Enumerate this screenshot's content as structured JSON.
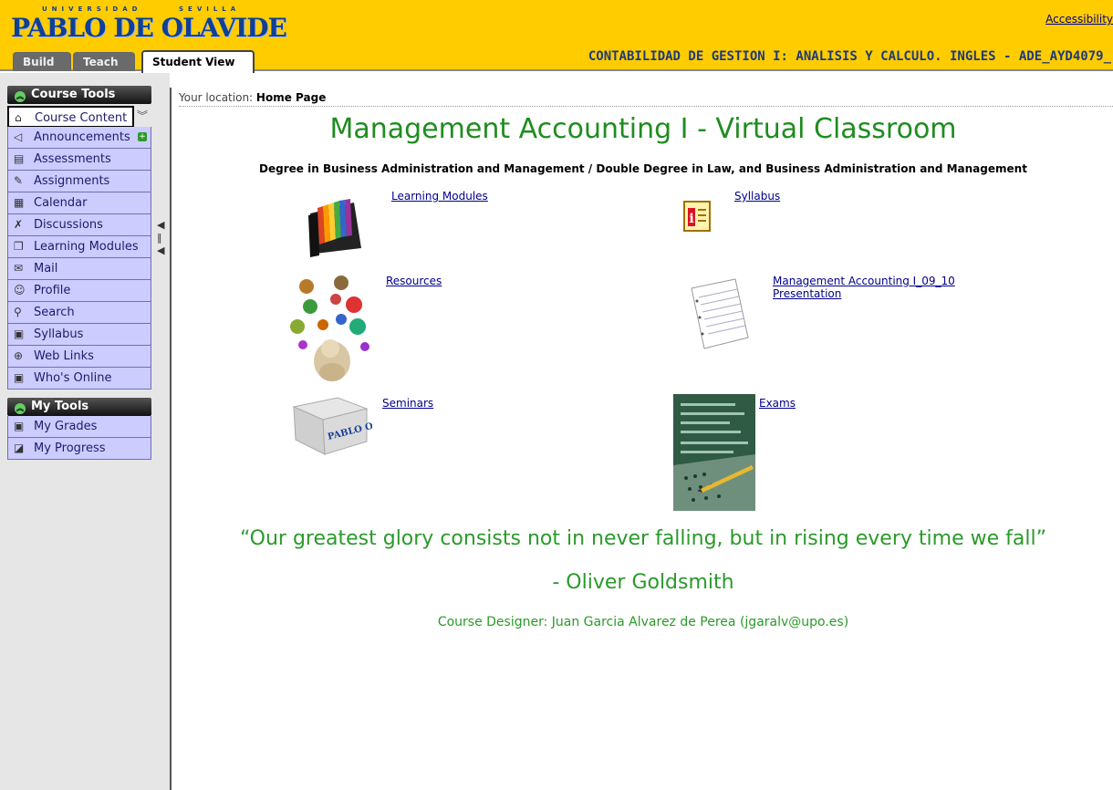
{
  "header": {
    "logo_small_left": "UNIVERSIDAD",
    "logo_small_right": "SEVILLA",
    "logo_text": "PABLO DE OLAVIDE",
    "accessibility_link": "Accessibility",
    "course_title": "CONTABILIDAD DE GESTION I: ANALISIS Y CALCULO. INGLES - ADE_AYD4079_",
    "tabs": [
      {
        "label": "Build"
      },
      {
        "label": "Teach"
      },
      {
        "label": "Student View"
      }
    ]
  },
  "sidebar": {
    "course_tools_header": "Course Tools",
    "course_tools": [
      {
        "label": "Course Content",
        "icon": "home-icon"
      },
      {
        "label": "Announcements",
        "icon": "megaphone-icon"
      },
      {
        "label": "Assessments",
        "icon": "assessment-icon"
      },
      {
        "label": "Assignments",
        "icon": "assignment-icon"
      },
      {
        "label": "Calendar",
        "icon": "calendar-icon"
      },
      {
        "label": "Discussions",
        "icon": "discussion-icon"
      },
      {
        "label": "Learning Modules",
        "icon": "module-icon"
      },
      {
        "label": "Mail",
        "icon": "mail-icon"
      },
      {
        "label": "Profile",
        "icon": "profile-icon"
      },
      {
        "label": "Search",
        "icon": "search-icon"
      },
      {
        "label": "Syllabus",
        "icon": "syllabus-icon"
      },
      {
        "label": "Web Links",
        "icon": "globe-icon"
      },
      {
        "label": "Who's Online",
        "icon": "online-icon"
      }
    ],
    "my_tools_header": "My Tools",
    "my_tools": [
      {
        "label": "My Grades",
        "icon": "grades-icon"
      },
      {
        "label": "My Progress",
        "icon": "progress-icon"
      }
    ]
  },
  "content": {
    "location_label": "Your location:",
    "location_value": "Home Page",
    "title": "Management Accounting I - Virtual Classroom",
    "degree_line": "Degree in Business Administration and Management / Double Degree in Law, and  Business Administration and Management",
    "links": {
      "learning_modules": "Learning Modules",
      "syllabus": "Syllabus",
      "resources": "Resources",
      "presentation_line1": "Management Accounting I_09_10",
      "presentation_line2": "Presentation",
      "seminars": "Seminars",
      "exams": "Exams"
    },
    "quote": "“Our greatest glory consists not in never falling, but in rising every time we fall”",
    "author": "- Oliver Goldsmith",
    "designer": "Course Designer: Juan Garcia Alvarez de Perea (jgaralv@upo.es)",
    "box_logo_text": "PABLO OLAVIDE"
  },
  "colors": {
    "header_yellow": "#ffcc00",
    "brand_blue": "#0f3f96",
    "nav_lavender": "#ccccff",
    "accent_green": "#2a9a2a"
  }
}
